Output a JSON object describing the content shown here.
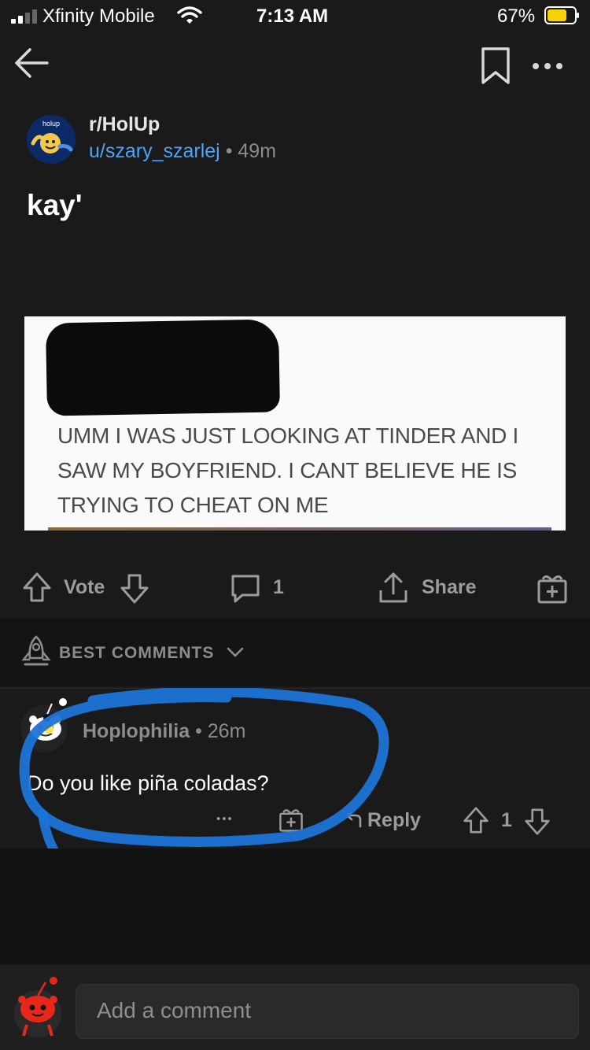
{
  "status_bar": {
    "carrier": "Xfinity Mobile",
    "time": "7:13 AM",
    "battery": "67%"
  },
  "nav": {
    "back_icon": "arrow-left-icon",
    "bookmark_icon": "bookmark-icon",
    "more_icon": "ellipsis-icon"
  },
  "post": {
    "subreddit": "r/HolUp",
    "avatar_text": "holup",
    "author": "u/szary_szarlej",
    "separator": "•",
    "age": "49m",
    "title": "kay'",
    "image_text": "UMM I WAS JUST LOOKING AT TINDER AND I SAW MY BOYFRIEND. I CANT BELIEVE HE IS TRYING TO CHEAT ON ME"
  },
  "actions": {
    "vote_label": "Vote",
    "comment_count": "1",
    "share_label": "Share"
  },
  "sort": {
    "label": "BEST COMMENTS"
  },
  "comment": {
    "author": "Hoplophilia",
    "separator": "•",
    "age": "26m",
    "body": "Do you like piña coladas?",
    "more": "•••",
    "reply_label": "Reply",
    "score": "1"
  },
  "composer": {
    "placeholder": "Add a comment"
  },
  "colors": {
    "background": "#1a1a1b",
    "link_blue": "#4fa3f7",
    "annotation_blue": "#1e74d8",
    "snoo_red": "#e8271b"
  }
}
